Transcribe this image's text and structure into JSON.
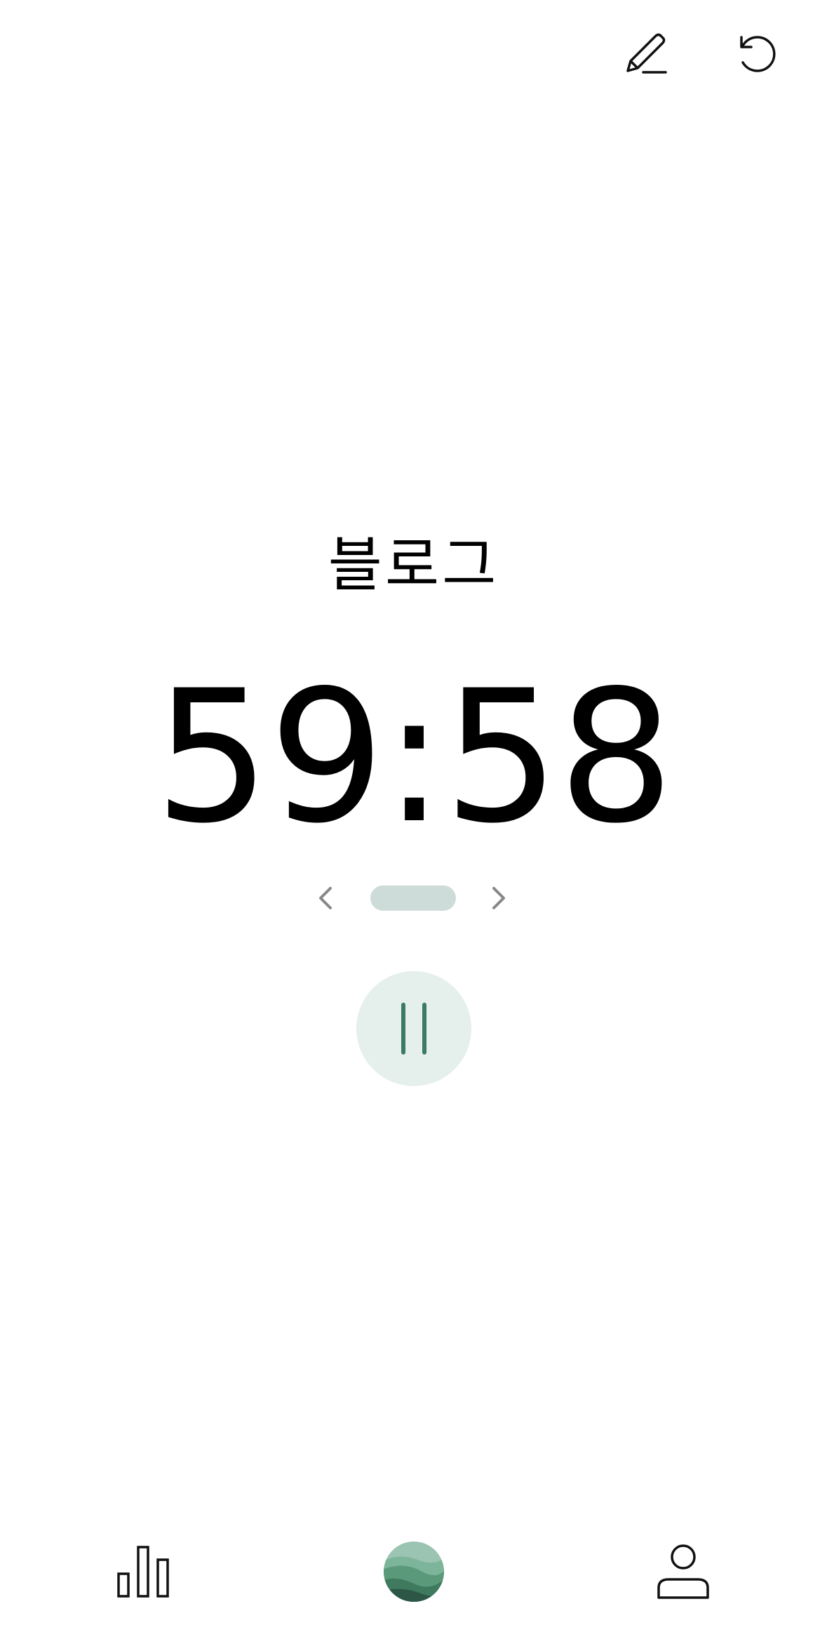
{
  "header": {
    "edit_icon": "pencil-icon",
    "reset_icon": "reset-icon"
  },
  "task": {
    "title": "블로그"
  },
  "timer": {
    "display": "59:58"
  },
  "pager": {
    "prev_icon": "chevron-left-icon",
    "next_icon": "chevron-right-icon",
    "indicator_color": "#cddcd8"
  },
  "controls": {
    "pause_icon": "pause-icon",
    "pause_bg": "#e5efec",
    "pause_fg": "#3d7a66"
  },
  "bottom_nav": {
    "items": [
      {
        "icon": "bar-chart-icon"
      },
      {
        "icon": "landscape-avatar-icon"
      },
      {
        "icon": "user-icon"
      }
    ]
  },
  "colors": {
    "accent": "#3d7a66",
    "icon": "#111111",
    "muted_icon": "#888888"
  }
}
